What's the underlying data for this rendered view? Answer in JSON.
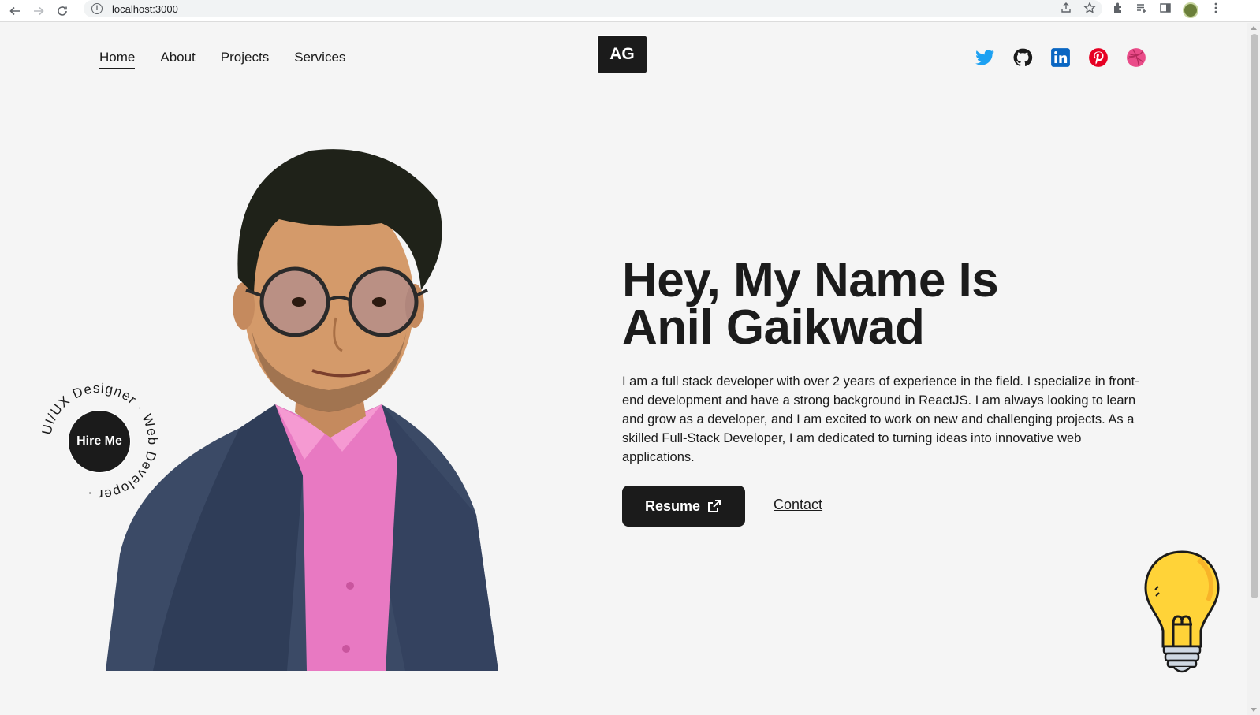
{
  "browser": {
    "url": "localhost:3000"
  },
  "nav": {
    "links": [
      "Home",
      "About",
      "Projects",
      "Services"
    ],
    "active": "Home"
  },
  "logo": "AG",
  "socials": [
    {
      "name": "twitter-icon",
      "color": "#1da1f2"
    },
    {
      "name": "github-icon",
      "color": "#1b1b1b"
    },
    {
      "name": "linkedin-icon",
      "color": "#0a66c2"
    },
    {
      "name": "pinterest-icon",
      "color": "#e60023"
    },
    {
      "name": "dribbble-icon",
      "color": "#ea4c89"
    }
  ],
  "hire": {
    "button": "Hire Me",
    "ring_text": "UI/UX Designer · Web Developer ·"
  },
  "hero": {
    "title_line1": "Hey, My Name Is",
    "title_line2": "Anil Gaikwad",
    "paragraph": "I am a full stack developer with over 2 years of experience in the field. I specialize in front-end development and have a strong background in ReactJS. I am always looking to learn and grow as a developer, and I am excited to work on new and challenging projects. As a skilled Full-Stack Developer, I am dedicated to turning ideas into innovative web applications.",
    "resume_label": "Resume",
    "contact_label": "Contact"
  },
  "colors": {
    "background": "#f5f5f5",
    "dark": "#1b1b1b",
    "bulb": "#ffd338"
  }
}
